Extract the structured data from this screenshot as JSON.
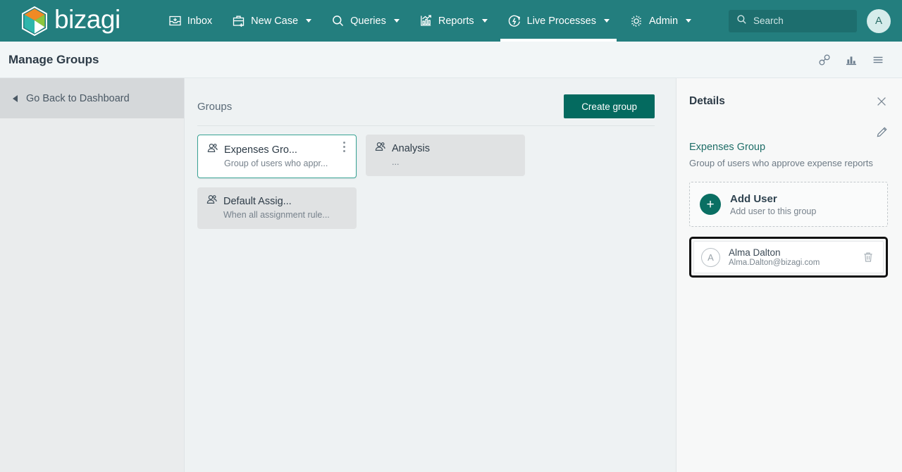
{
  "topnav": {
    "brand": "bizagi",
    "items": [
      {
        "label": "Inbox",
        "icon": "inbox-icon",
        "caret": false,
        "active": false
      },
      {
        "label": "New Case",
        "icon": "briefcase-plus-icon",
        "caret": true,
        "active": false
      },
      {
        "label": "Queries",
        "icon": "search-icon",
        "caret": true,
        "active": false
      },
      {
        "label": "Reports",
        "icon": "chart-icon",
        "caret": true,
        "active": false
      },
      {
        "label": "Live Processes",
        "icon": "live-process-icon",
        "caret": true,
        "active": true
      },
      {
        "label": "Admin",
        "icon": "gear-icon",
        "caret": true,
        "active": false
      }
    ],
    "search": {
      "placeholder": "Search",
      "value": ""
    },
    "avatar": "A"
  },
  "titlebar": {
    "title": "Manage Groups",
    "actions": [
      {
        "name": "link-icon"
      },
      {
        "name": "bar-chart-icon"
      },
      {
        "name": "hamburger-menu-icon"
      }
    ]
  },
  "sidebar": {
    "back_label": "Go Back to Dashboard"
  },
  "main": {
    "section_label": "Groups",
    "create_button": "Create group",
    "cards": [
      {
        "title": "Expenses Gro...",
        "subtitle": "Group of users who appr...",
        "selected": true,
        "has_menu": true
      },
      {
        "title": "Analysis",
        "subtitle": "...",
        "selected": false,
        "has_menu": false
      },
      {
        "title": "Default Assig...",
        "subtitle": "When all assignment rule...",
        "selected": false,
        "has_menu": false
      }
    ]
  },
  "details": {
    "title": "Details",
    "group_name": "Expenses Group",
    "group_description": "Group of users who approve expense reports",
    "add_user": {
      "title": "Add User",
      "subtitle": "Add user to this group"
    },
    "users": [
      {
        "initial": "A",
        "name": "Alma Dalton",
        "email": "Alma.Dalton@bizagi.com",
        "highlighted": true
      }
    ]
  },
  "colors": {
    "nav_teal": "#237e7e",
    "accent_green": "#046a5f",
    "selected_border": "#38a394",
    "highlight_outline": "#111111",
    "page_bg": "#eef2f3"
  }
}
